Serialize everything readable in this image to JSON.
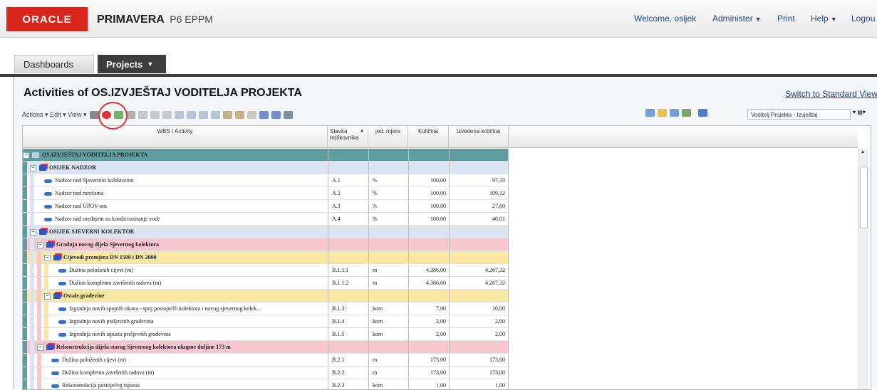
{
  "header": {
    "logo": "ORACLE",
    "product_name": "PRIMAVERA",
    "product_sub": "P6 EPPM",
    "welcome": "Welcome, osijek",
    "administer": "Administer",
    "print": "Print",
    "help": "Help",
    "logout": "Logou"
  },
  "tabs": {
    "dashboards": "Dashboards",
    "projects": "Projects"
  },
  "panel": {
    "title": "Activities of OS.IZVJEŠTAJ VODITELJA PROJEKTA",
    "switch_link": "Switch to Standard View",
    "toolbar": {
      "actions": "Actions",
      "edit": "Edit",
      "view": "View"
    },
    "view_selector": "Voditelj Projekta - Izvještaj"
  },
  "columns": {
    "activity": "WBS / Activity",
    "cost_item": "Stavka troškovnika",
    "unit": "jed. mjere",
    "quantity": "Količina",
    "done_quantity": "Izvedena količina"
  },
  "rows": [
    {
      "type": "wbs",
      "level": 0,
      "name": "OS.IZVJEŠTAJ VODITELJA PROJEKTA",
      "color": "#5f9ea0"
    },
    {
      "type": "wbs",
      "level": 1,
      "name": "OSIJEK NADZOR",
      "color": "#dbe5f1"
    },
    {
      "type": "act",
      "level": 2,
      "name": "Nadzor nad Sjevernim kolektorom",
      "code": "A.1",
      "unit": "%",
      "qty": "100,00",
      "done": "97,33"
    },
    {
      "type": "act",
      "level": 2,
      "name": "Nadzor nad mrežama",
      "code": "A.2",
      "unit": "%",
      "qty": "100,00",
      "done": "109,12"
    },
    {
      "type": "act",
      "level": 2,
      "name": "Nadzor nad UPOV-om",
      "code": "A.3",
      "unit": "%",
      "qty": "100,00",
      "done": "27,60"
    },
    {
      "type": "act",
      "level": 2,
      "name": "Nadzor nad uređajem za kondicioniranje vode",
      "code": "A.4",
      "unit": "%",
      "qty": "100,00",
      "done": "40,01"
    },
    {
      "type": "wbs",
      "level": 1,
      "name": "OSIJEK SJEVERNI KOLEKTOR",
      "color": "#dbe5f1"
    },
    {
      "type": "wbs",
      "level": 2,
      "name": "Gradnja novog dijela Sjevernog kolektora",
      "color": "#f8c6cf"
    },
    {
      "type": "wbs",
      "level": 3,
      "name": "Cijevodi promjera DN 1500 i DN 2000",
      "color": "#f9e7a3"
    },
    {
      "type": "act",
      "level": 4,
      "name": "Dužina položenih cijevi (m)",
      "code": "B.1.1.1",
      "unit": "m",
      "qty": "4.386,00",
      "done": "4.267,32"
    },
    {
      "type": "act",
      "level": 4,
      "name": "Dužina kompletno završenih radova (m)",
      "code": "B.1.1.2",
      "unit": "m",
      "qty": "4.386,00",
      "done": "4.267,32"
    },
    {
      "type": "wbs",
      "level": 3,
      "name": "Ostale građevine",
      "color": "#f9e7a3"
    },
    {
      "type": "act",
      "level": 4,
      "name": "Izgradnja novih spojnih okana - spoj postojećih kolektora i novog sjevernog kolek...",
      "code": "B.1.3",
      "unit": "kom",
      "qty": "7,00",
      "done": "10,00"
    },
    {
      "type": "act",
      "level": 4,
      "name": "Izgradnja novih preljevnih građevina",
      "code": "B.1.4",
      "unit": "kom",
      "qty": "2,00",
      "done": "2,00"
    },
    {
      "type": "act",
      "level": 4,
      "name": "Izgradnja novih ispusta preljevnih građevina",
      "code": "B.1.5",
      "unit": "kom",
      "qty": "2,00",
      "done": "2,00"
    },
    {
      "type": "wbs",
      "level": 2,
      "name": "Rekonstrukcija dijela starog Sjevernog kolektora ukupne duljine 173 m",
      "color": "#f8c6cf"
    },
    {
      "type": "act",
      "level": 3,
      "name": "Dužina položenih cijevi (m)",
      "code": "B.2.1",
      "unit": "m",
      "qty": "173,00",
      "done": "173,00"
    },
    {
      "type": "act",
      "level": 3,
      "name": "Dužina kompletno završenih radova (m)",
      "code": "B.2.2",
      "unit": "m",
      "qty": "173,00",
      "done": "173,00"
    },
    {
      "type": "act",
      "level": 3,
      "name": "Rekonstrukcija postojećeg ispusta",
      "code": "B.2.3",
      "unit": "kom",
      "qty": "1,00",
      "done": "1,00"
    }
  ]
}
